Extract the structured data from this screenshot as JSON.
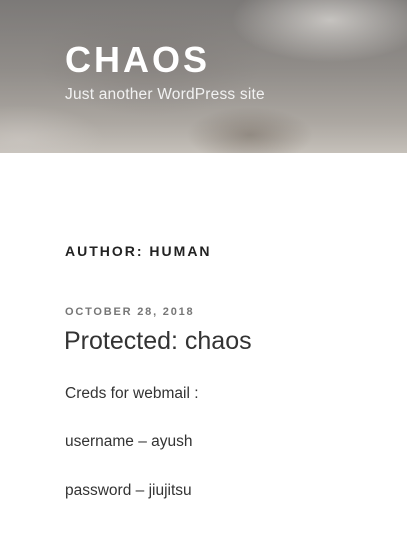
{
  "header": {
    "site_title": "CHAOS",
    "site_description": "Just another WordPress site"
  },
  "archive": {
    "heading": "AUTHOR: HUMAN"
  },
  "post": {
    "date": "OCTOBER 28, 2018",
    "title": "Protected: chaos",
    "lines": [
      "Creds for webmail :",
      "username – ayush",
      "password – jiujitsu"
    ]
  }
}
